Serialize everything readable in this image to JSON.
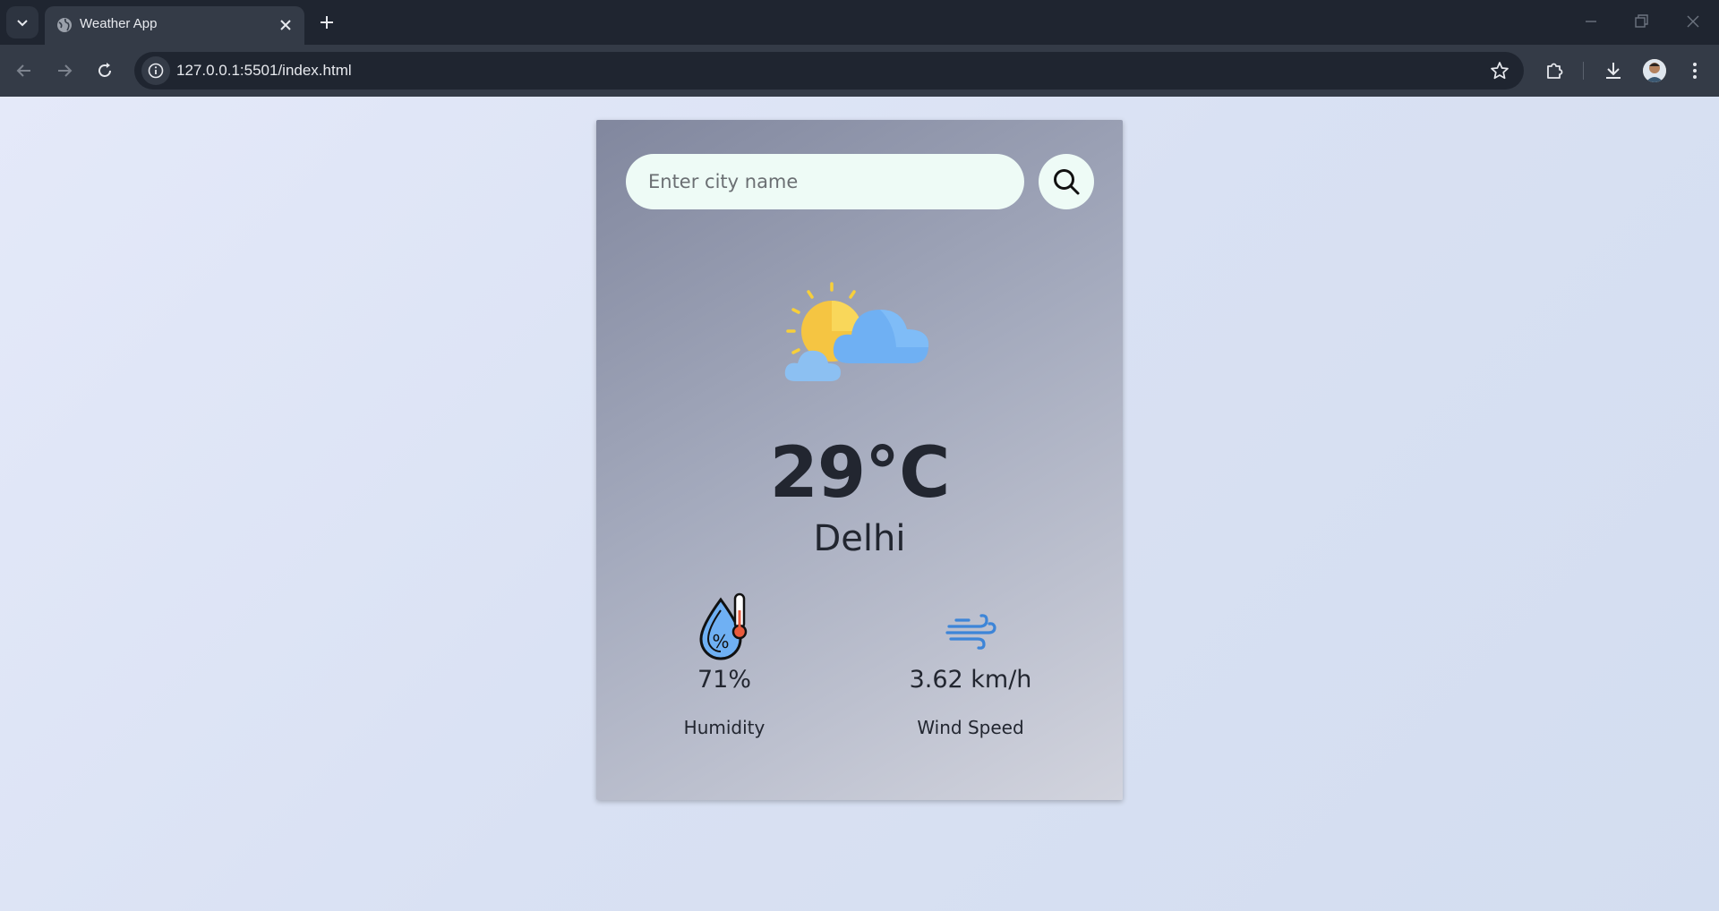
{
  "browser": {
    "tab_title": "Weather App",
    "url": "127.0.0.1:5501/index.html"
  },
  "search": {
    "placeholder": "Enter city name",
    "value": ""
  },
  "weather": {
    "icon": "partly-cloudy-icon",
    "temperature": "29°C",
    "city": "Delhi"
  },
  "details": {
    "humidity": {
      "icon": "humidity-icon",
      "value": "71%",
      "label": "Humidity"
    },
    "wind": {
      "icon": "wind-icon",
      "value": "3.62 km/h",
      "label": "Wind Speed"
    }
  },
  "colors": {
    "chrome_dark": "#1f2530",
    "chrome_toolbar": "#343b47",
    "input_bg": "#eefbf6",
    "text_dark": "#222630"
  }
}
